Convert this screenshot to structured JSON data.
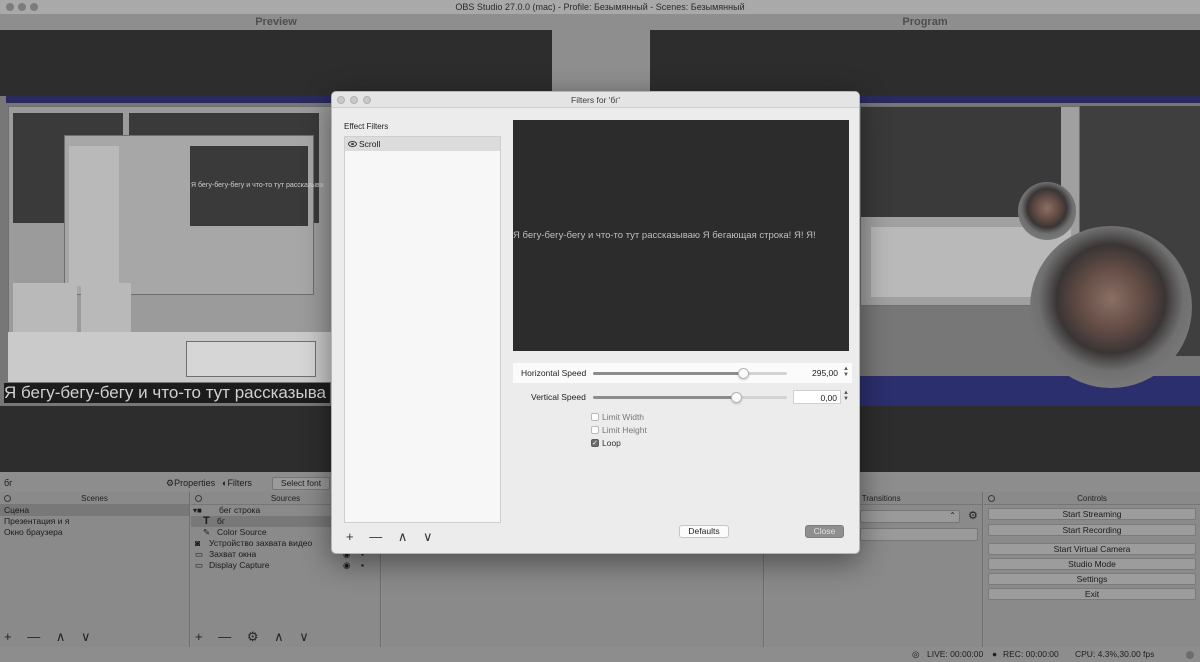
{
  "window": {
    "title": "OBS Studio 27.0.0 (mac) - Profile: Безымянный - Scenes: Безымянный"
  },
  "preview": {
    "label": "Preview"
  },
  "program": {
    "label": "Program"
  },
  "captured": {
    "marquee_text": "Я бегу-бегу-бегу и что-то тут рассказыва",
    "marquee_small": "Я бегу-бегу-бегу и что-то тут рассказыва"
  },
  "source_toolbar": {
    "selected_source": "бг",
    "properties_label": "Properties",
    "filters_label": "Filters",
    "select_font_label": "Select font"
  },
  "scenes_dock": {
    "title": "Scenes",
    "items": [
      "Сцена",
      "Презентация и я",
      "Окно браузера"
    ],
    "footer": "+ — ∧ ∨"
  },
  "sources_dock": {
    "title": "Sources",
    "items": [
      {
        "label": "бег строка",
        "icon": "folder-icon"
      },
      {
        "label": "бг",
        "icon": "text-icon"
      },
      {
        "label": "Color Source",
        "icon": "brush-icon"
      },
      {
        "label": "Устройство захвата видео",
        "icon": "camera-icon"
      },
      {
        "label": "Захват окна",
        "icon": "window-icon"
      },
      {
        "label": "Display Capture",
        "icon": "monitor-icon"
      }
    ],
    "footer": "+ — ⚙ ∧ ∨"
  },
  "transitions_dock": {
    "title": "ene Transitions"
  },
  "controls_dock": {
    "title": "Controls",
    "buttons": [
      "Start Streaming",
      "Start Recording",
      "Start Virtual Camera",
      "Studio Mode",
      "Settings",
      "Exit"
    ]
  },
  "status": {
    "live": "LIVE: 00:00:00",
    "rec": "REC: 00:00:00",
    "cpu": "CPU: 4.3%,30.00 fps"
  },
  "filters_dialog": {
    "title": "Filters for 'бг'",
    "effect_filters_label": "Effect Filters",
    "filters": [
      "Scroll"
    ],
    "list_tools": "+ — ∧ ∨",
    "preview_text": "Я бегу-бегу-бегу и что-то тут рассказываю Я бегающая строка! Я! Я!",
    "horizontal_speed": {
      "label": "Horizontal Speed",
      "value": "295,00",
      "fraction": 0.78
    },
    "vertical_speed": {
      "label": "Vertical Speed",
      "value": "0,00",
      "fraction": 0.74
    },
    "limit_width": {
      "label": "Limit Width",
      "checked": false
    },
    "limit_height": {
      "label": "Limit Height",
      "checked": false
    },
    "loop": {
      "label": "Loop",
      "checked": true
    },
    "defaults_label": "Defaults",
    "close_label": "Close"
  }
}
